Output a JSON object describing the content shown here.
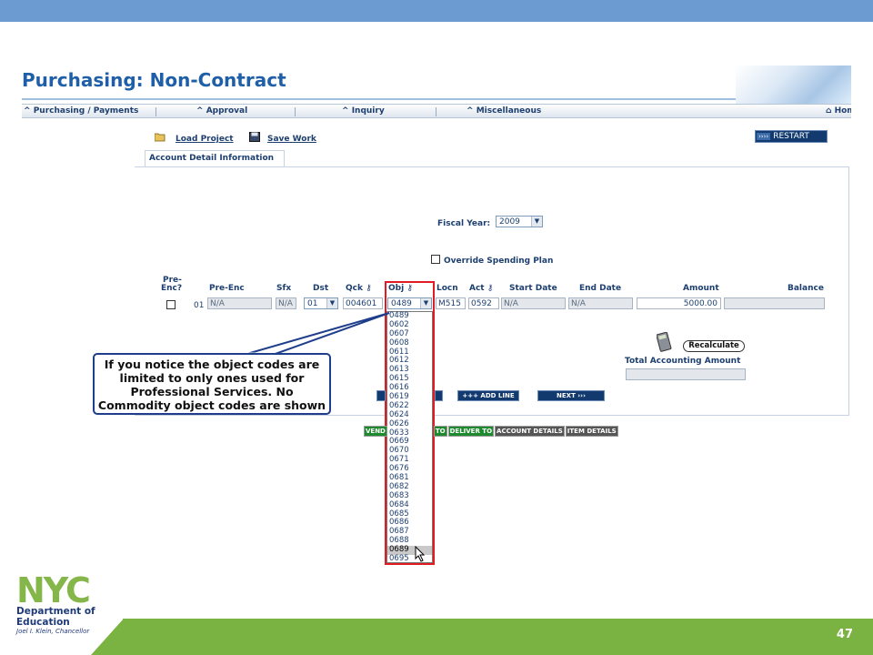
{
  "page": {
    "title": "Purchasing: Non-Contract",
    "page_number": "47"
  },
  "nav": {
    "items": [
      "Purchasing / Payments",
      "Approval",
      "Inquiry",
      "Miscellaneous",
      "Hom"
    ]
  },
  "toolbar": {
    "load_label": "Load Project",
    "save_label": "Save Work",
    "restart_label": "RESTART",
    "restart_arrows": "››››"
  },
  "tab": {
    "label": "Account Detail Information"
  },
  "form": {
    "fiscal_year_label": "Fiscal Year:",
    "fiscal_year_value": "2009",
    "override_label": "Override Spending Plan",
    "columns": {
      "preenc_top": "Pre-",
      "preenc_bottom": "Enc?",
      "pre_enc": "Pre-Enc",
      "sfx": "Sfx",
      "dst": "Dst",
      "qck": "Qck",
      "obj": "Obj",
      "locn": "Locn",
      "act": "Act",
      "start_date": "Start Date",
      "end_date": "End Date",
      "amount": "Amount",
      "balance": "Balance"
    },
    "row": {
      "line": "01",
      "pre_enc": "N/A",
      "sfx": "N/A",
      "dst": "01",
      "qck": "004601",
      "obj": "0489",
      "locn": "M515",
      "act": "0592",
      "start_date": "N/A",
      "end_date": "N/A",
      "amount": "5000.00",
      "balance": ""
    }
  },
  "obj_options": [
    "0489",
    "0602",
    "0607",
    "0608",
    "0611",
    "0612",
    "0613",
    "0615",
    "0616",
    "0619",
    "0622",
    "0624",
    "0626",
    "0633",
    "0669",
    "0670",
    "0671",
    "0676",
    "0681",
    "0682",
    "0683",
    "0684",
    "0685",
    "0686",
    "0687",
    "0688",
    "0689",
    "0695"
  ],
  "obj_highlighted": "0689",
  "actions": {
    "recalculate": "Recalculate",
    "total_label": "Total Accounting Amount",
    "add_line": "ADD LINE",
    "add_line_prefix": "+++",
    "next": "NEXT",
    "next_suffix": "›››"
  },
  "status_tabs": [
    "VEND",
    "TO",
    "DELIVER TO",
    "ACCOUNT DETAILS",
    "ITEM DETAILS"
  ],
  "callout": {
    "text": "If you notice the object codes are limited to only ones used for Professional Services.  No Commodity object codes are shown"
  },
  "logo": {
    "nyc": "NYC",
    "dept_line1": "Department of",
    "dept_line2": "Education",
    "chancellor": "Joel I. Klein, Chancellor"
  },
  "colors": {
    "accent": "#6b9bd1",
    "footer": "#7ab341",
    "highlight": "#e21b23",
    "callout_border": "#1e3d8a"
  }
}
